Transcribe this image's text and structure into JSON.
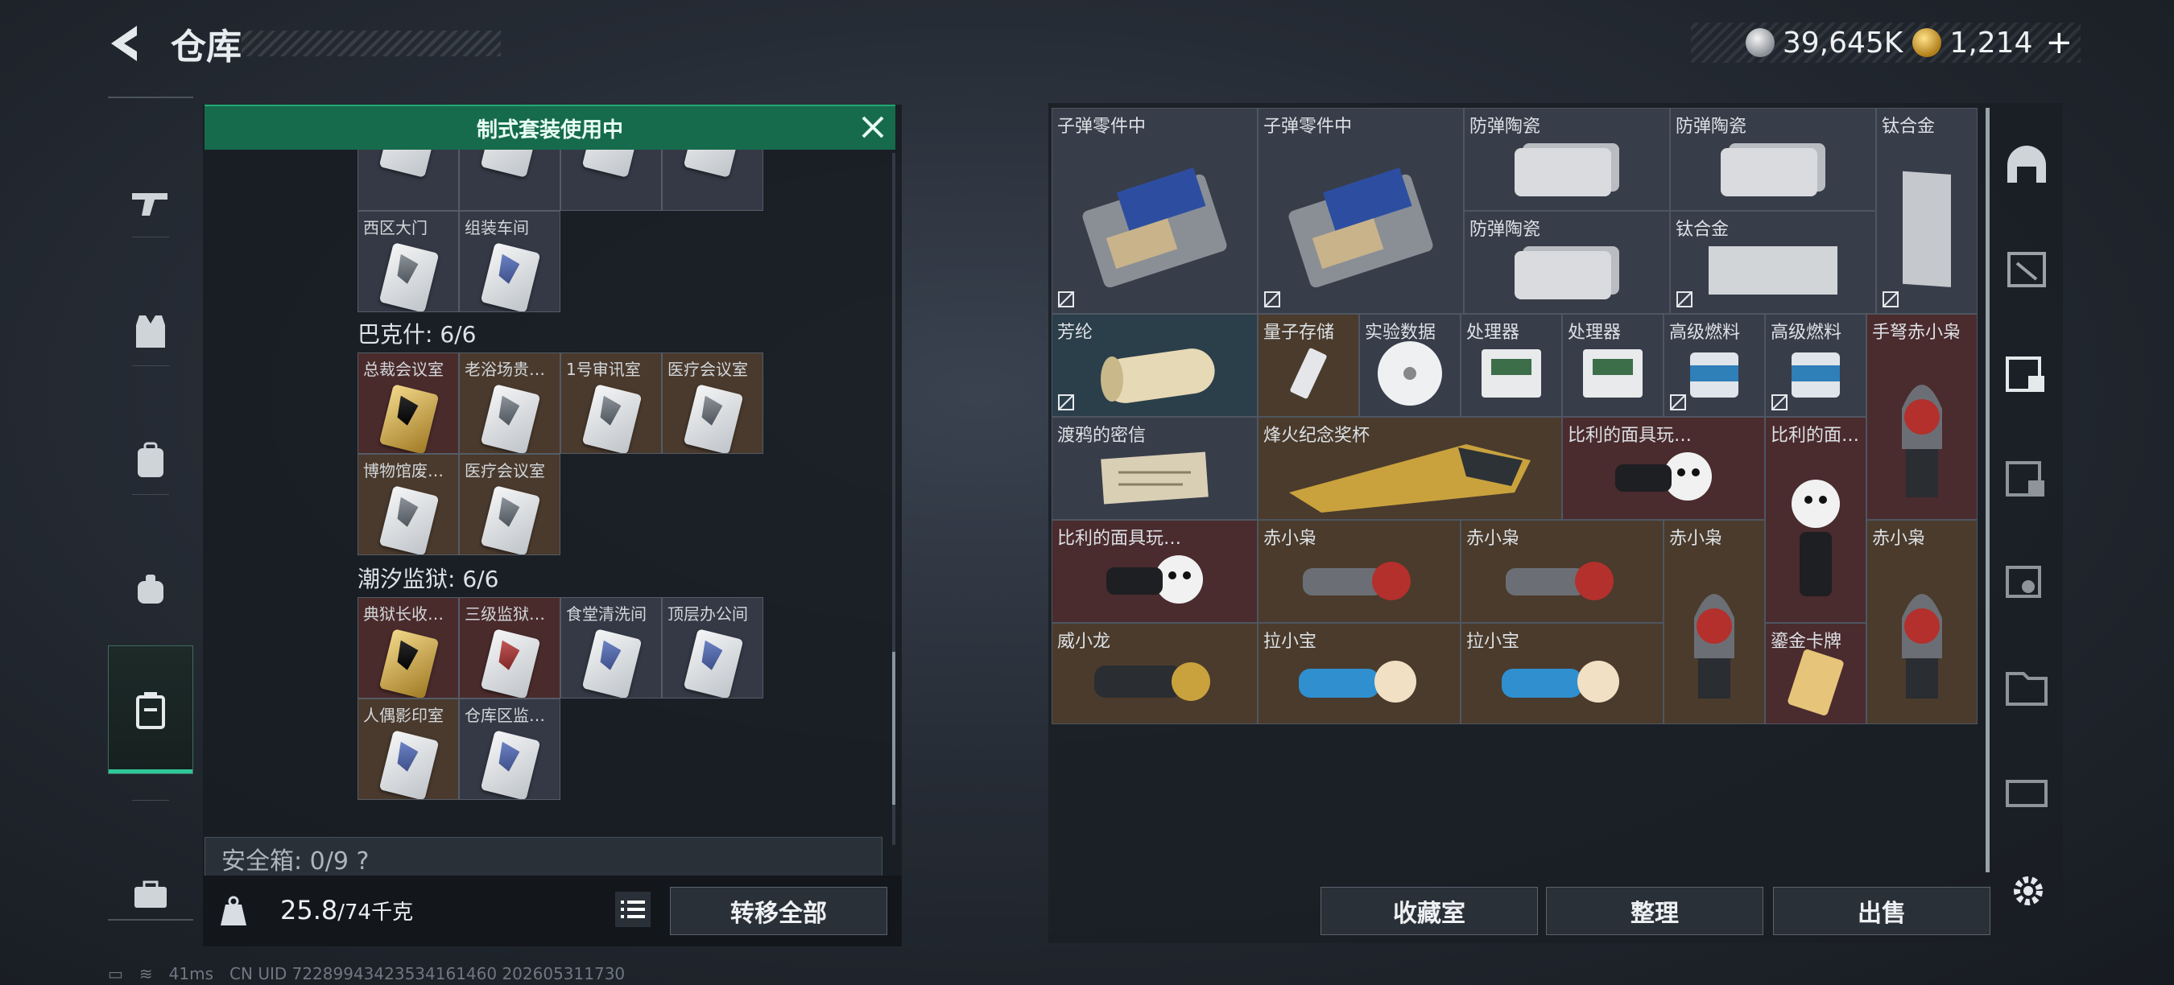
{
  "header": {
    "title": "仓库"
  },
  "currency": {
    "silver": "39,645K",
    "gold": "1,214"
  },
  "banner": {
    "text": "制式套装使用中"
  },
  "sections": {
    "top_labels": [
      "西区大门",
      "组装车间"
    ],
    "bakeshi": {
      "title": "巴克什: 6/6",
      "items": [
        "总裁会议室",
        "老浴场贵…",
        "1号审讯室",
        "医疗会议室",
        "博物馆废…",
        "医疗会议室"
      ]
    },
    "chaoxi": {
      "title": "潮汐监狱: 6/6",
      "items": [
        "典狱长收…",
        "三级监狱…",
        "食堂清洗间",
        "顶层办公间",
        "人偶影印室",
        "仓库区监…"
      ]
    }
  },
  "safe_box": "安全箱: 0/9 ?",
  "footer": {
    "weight": "25.8",
    "weight_cap": "/74千克",
    "move_all": "转移全部"
  },
  "grid_items": [
    "子弹零件中",
    "子弹零件中",
    "防弹陶瓷",
    "防弹陶瓷",
    "钛合金",
    "防弹陶瓷",
    "钛合金",
    "芳纶",
    "量子存储",
    "实验数据",
    "处理器",
    "处理器",
    "高级燃料",
    "高级燃料",
    "手弩赤小枭",
    "渡鸦的密信",
    "烽火纪念奖杯",
    "比利的面具玩…",
    "比利的面…",
    "比利的面具玩…",
    "赤小枭",
    "赤小枭",
    "赤小枭",
    "赤小枭",
    "威小龙",
    "拉小宝",
    "拉小宝",
    "鎏金卡牌"
  ],
  "actions": {
    "collection": "收藏室",
    "sort": "整理",
    "sell": "出售"
  },
  "status": {
    "ping": "41ms",
    "uid": "CN UID 72289943423534161460 202605311730"
  },
  "colors": {
    "accent": "#2fc79a",
    "banner": "#176b4d"
  }
}
